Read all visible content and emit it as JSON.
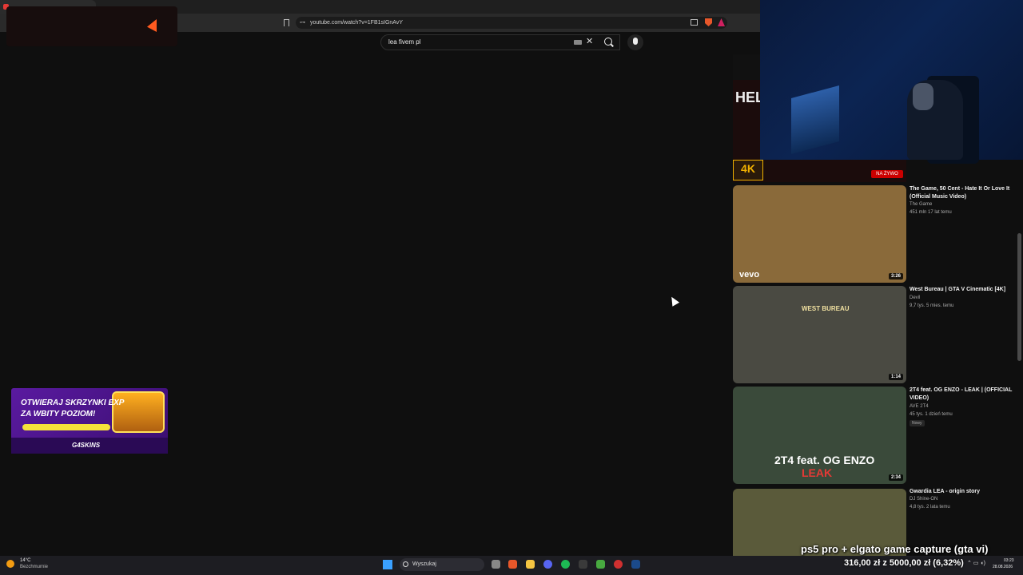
{
  "browser": {
    "tab_title": "",
    "url": "youtube.com/watch?v=1FB1sIGnAvY"
  },
  "youtube": {
    "search_value": "lea fivem pl"
  },
  "sidebar": {
    "top_thumb_text": "HEL",
    "four_k_label": "4K",
    "live_label": "NA ŻYWO",
    "videos": [
      {
        "title": "The Game, 50 Cent - Hate It Or Love It (Official Music Video)",
        "channel": "The Game",
        "meta": "451 mln  17 lat temu",
        "duration": "3:26",
        "thumb_color": "#8a6a3a",
        "thumb_text": "vevo",
        "new": ""
      },
      {
        "title": "West Bureau | GTA V Cinematic [4K]",
        "channel": "Devil",
        "meta": "9,7 tys.  5 mies. temu",
        "duration": "1:14",
        "thumb_color": "#4a4a42",
        "thumb_text": "WEST BUREAU",
        "new": ""
      },
      {
        "title": "2T4 feat. OG ENZO - LEAK | (OFFICIAL VIDEO)",
        "channel": "AVE 2T4",
        "meta": "45 tys.  1 dzień temu",
        "duration": "2:34",
        "thumb_color": "#3a4a3a",
        "thumb_text": "2T4 feat. OG ENZO",
        "thumb_text2": "LEAK",
        "new": "Nowy"
      },
      {
        "title": "Gwardia LEA - origin story",
        "channel": "DJ Shine-ON",
        "meta": "4,8 tys.  2 lata temu",
        "duration": "",
        "thumb_color": "#5a5a3a",
        "thumb_text": "",
        "new": ""
      }
    ]
  },
  "ad": {
    "line1": "OTWIERAJ SKRZYNKI EXP",
    "line2": "ZA WBITY POZIOM!",
    "logo": "G4SKINS"
  },
  "taskbar": {
    "weather_temp": "14°C",
    "weather_desc": "Bezchmurnie",
    "search_placeholder": "Wyszukaj",
    "time": "03:23",
    "date": "28.08.2026"
  },
  "stream": {
    "title": "ps5 pro + elgato game capture (gta vi)",
    "donation": "316,00 zł  z  5000,00 zł  (6,32%)"
  },
  "colors": {
    "background": "#0f0f0f",
    "accent_red": "#cc0000"
  }
}
